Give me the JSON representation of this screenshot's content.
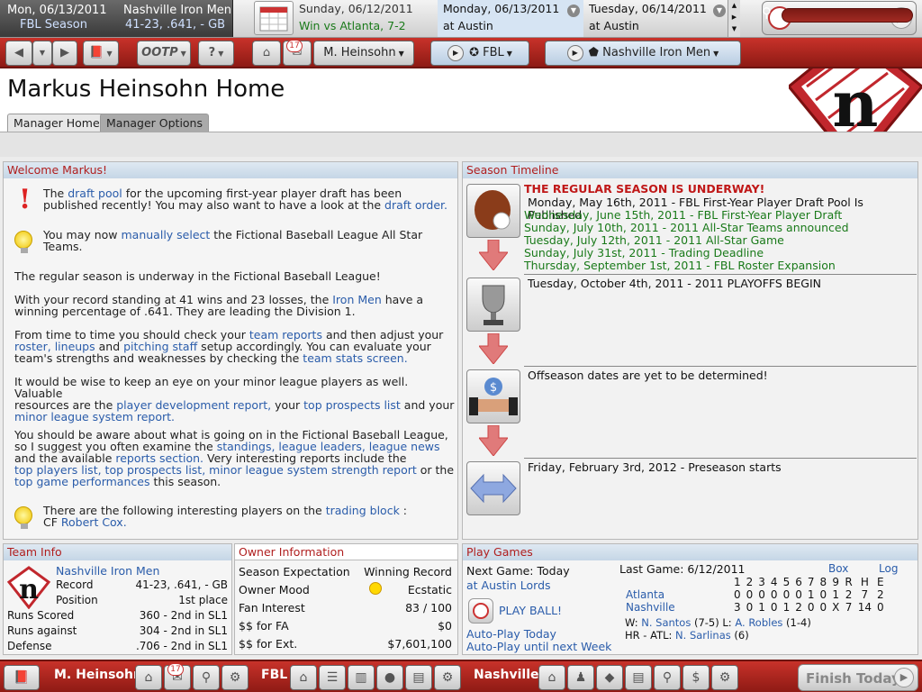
{
  "topbar": {
    "current_date": "Mon, 06/13/2011",
    "season_label": "FBL Season",
    "team_name": "Nashville Iron Men",
    "team_record": "41-23, .641, - GB",
    "games": [
      {
        "date": "Sunday, 06/12/2011",
        "detail": "Win vs Atlanta, 7-2"
      },
      {
        "date": "Monday, 06/13/2011",
        "detail": "at Austin"
      },
      {
        "date": "Tuesday, 06/14/2011",
        "detail": "at Austin"
      }
    ],
    "finish_label": "Finish Today"
  },
  "navbar": {
    "ootp_label": "OOTP",
    "help_label": "?",
    "mail_count": "17",
    "manager_label": "M. Heinsohn",
    "league_label": "FBL",
    "team_label": "Nashville Iron Men"
  },
  "header": {
    "title": "Markus Heinsohn Home",
    "tabs": [
      "Manager Home",
      "Manager Options"
    ]
  },
  "welcome": {
    "title": "Welcome Markus!",
    "p1": {
      "a": "The ",
      "l1": "draft pool",
      "b": " for the upcoming first-year player draft has been",
      "c": "published recently! You may also want to have a look at the ",
      "l2": "draft order."
    },
    "p2": {
      "a": "You may now ",
      "l1": "manually select",
      "b": " the Fictional Baseball League All Star",
      "c": "Teams."
    },
    "p3": "The regular season is underway in the Fictional Baseball League!",
    "p4": {
      "a": "With your record standing at 41 wins and 23 losses, the ",
      "l1": "Iron Men",
      "b": " have a",
      "c": "winning percentage of .641. They are leading the Division 1."
    },
    "p5": {
      "a": "From time to time you should check your ",
      "l1": "team reports",
      "b": " and then adjust your",
      "l2": "roster, lineups",
      "c": " and ",
      "l3": "pitching staff",
      "d": " setup accordingly. You can evaluate your",
      "e": "team's strengths and weaknesses by checking the ",
      "l4": "team stats screen."
    },
    "p6": {
      "a": "It would be wise to keep an eye on your minor league players as well. Valuable",
      "b": "resources are the ",
      "l1": "player development report,",
      "c": " your ",
      "l2": "top prospects list",
      "d": " and your",
      "l3": "minor league system report."
    },
    "p7": {
      "a": "You should be aware about what is going on in the Fictional Baseball League,",
      "b": "so I suggest you often examine the ",
      "l1": "standings, league leaders, league news",
      "c": "and the available ",
      "l2": "reports section.",
      "d": " Very interesting reports include the",
      "l3": "top players list, top prospects list, minor league system strength report",
      "e": " or the",
      "l4": "top game performances",
      "f": " this season."
    },
    "p8": {
      "a": "There are the following interesting players on the ",
      "l1": "trading block",
      "b": " :",
      "c": "CF ",
      "l2": "Robert Cox."
    }
  },
  "timeline": {
    "title": "Season Timeline",
    "underway": "THE REGULAR SEASON IS UNDERWAY!",
    "events1": [
      "Monday, May 16th, 2011 - FBL First-Year Player Draft Pool Is Published",
      "Wednesday, June 15th, 2011 - FBL First-Year Player Draft",
      "Sunday, July 10th, 2011 - 2011 All-Star Teams announced",
      "Tuesday, July 12th, 2011 - 2011 All-Star Game",
      "Sunday, July 31st, 2011 - Trading Deadline",
      "Thursday, September 1st, 2011 - FBL Roster Expansion"
    ],
    "playoffs": "Tuesday, October 4th, 2011 - 2011 PLAYOFFS BEGIN",
    "offseason": "Offseason dates are yet to be determined!",
    "preseason": "Friday, February 3rd, 2012 - Preseason starts"
  },
  "teaminfo": {
    "title": "Team Info",
    "team": "Nashville Iron Men",
    "rows": [
      {
        "k": "Record",
        "v": "41-23, .641, - GB"
      },
      {
        "k": "Position",
        "v": "1st place"
      },
      {
        "k": "Runs Scored",
        "v": "360 - 2nd  in SL1"
      },
      {
        "k": "Runs against",
        "v": "304 - 2nd  in SL1"
      },
      {
        "k": "Defense",
        "v": ".706 - 2nd  in SL1"
      }
    ]
  },
  "owner": {
    "title": "Owner Information",
    "rows": [
      {
        "k": "Season Expectation",
        "v": "Winning Record"
      },
      {
        "k": "Owner Mood",
        "v": "Ecstatic"
      },
      {
        "k": "Fan Interest",
        "v": "83 / 100"
      },
      {
        "k": "$$ for FA",
        "v": "$0"
      },
      {
        "k": "$$ for Ext.",
        "v": "$7,601,100"
      }
    ]
  },
  "play": {
    "title": "Play Games",
    "next_game": "Next Game: Today",
    "opponent": "at Austin Lords",
    "play_ball": "PLAY BALL!",
    "autoplay_today": "Auto-Play Today",
    "autoplay_week": "Auto-Play until next Week",
    "last_game": "Last Game: 6/12/2011",
    "box": "Box",
    "log": "Log",
    "header": [
      "1",
      "2",
      "3",
      "4",
      "5",
      "6",
      "7",
      "8",
      "9",
      "R",
      "H",
      "E"
    ],
    "away": {
      "team": "Atlanta",
      "line": [
        "0",
        "0",
        "0",
        "0",
        "0",
        "0",
        "1",
        "0",
        "1",
        "2",
        "7",
        "2"
      ]
    },
    "home": {
      "team": "Nashville",
      "line": [
        "3",
        "0",
        "1",
        "0",
        "1",
        "2",
        "0",
        "0",
        "X",
        "7",
        "14",
        "0"
      ]
    },
    "wl_a": "W: ",
    "winner": "N. Santos",
    "wl_b": " (7-5) L: ",
    "loser": "A. Robles",
    "wl_c": " (1-4)",
    "hr_a": "HR - ATL: ",
    "hr_player": "N. Sarlinas",
    "hr_b": " (6)"
  },
  "bottombar": {
    "manager": "M. Heinsohn",
    "mail_count": "17",
    "league": "FBL",
    "team": "Nashville",
    "finish_label": "Finish Today"
  }
}
